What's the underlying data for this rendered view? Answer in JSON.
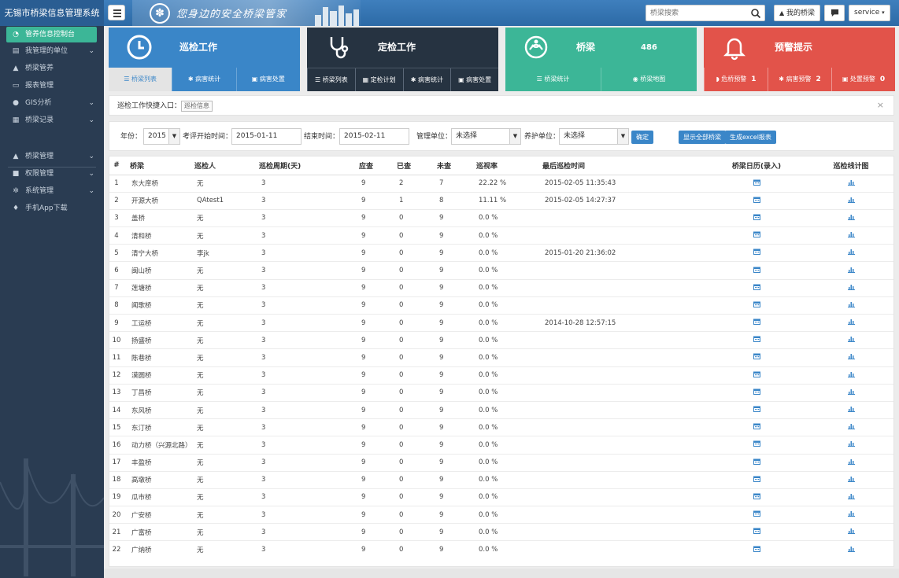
{
  "app": {
    "title": "无锡市桥梁信息管理系统",
    "slogan": "您身边的安全桥梁管家"
  },
  "header": {
    "search_placeholder": "桥梁搜索",
    "my_bridge_label": "我的桥梁",
    "user_label": "service"
  },
  "sidebar": {
    "items": [
      {
        "icon": "dashboard-icon",
        "label": "管养信息控制台",
        "active": true,
        "chevron": false
      },
      {
        "icon": "document-icon",
        "label": "我管理的单位",
        "chevron": true
      },
      {
        "icon": "road-icon",
        "label": "桥梁管养",
        "chevron": false
      },
      {
        "icon": "report-icon",
        "label": "报表管理",
        "chevron": false
      },
      {
        "icon": "map-marker-icon",
        "label": "GIS分析",
        "chevron": true
      },
      {
        "icon": "film-icon",
        "label": "桥梁记录",
        "chevron": true
      },
      {
        "icon": "road-icon",
        "label": "桥梁管理",
        "chevron": true
      },
      {
        "icon": "lock-icon",
        "label": "权限管理",
        "chevron": true
      },
      {
        "icon": "gear-icon",
        "label": "系统管理",
        "chevron": true
      },
      {
        "icon": "android-icon",
        "label": "手机App下载",
        "chevron": false
      }
    ]
  },
  "tiles": [
    {
      "title": "巡检工作",
      "color": "#3a86c8",
      "footer_color": "#e9e9e9",
      "icon": "clock-icon",
      "links": [
        {
          "icon": "list-icon",
          "label": "桥梁列表"
        },
        {
          "icon": "bug-icon",
          "label": "病害统计"
        },
        {
          "icon": "medkit-icon",
          "label": "病害处置"
        }
      ]
    },
    {
      "title": "定检工作",
      "color": "#263341",
      "icon": "stethoscope-icon",
      "links": [
        {
          "icon": "list-icon",
          "label": "桥梁列表"
        },
        {
          "icon": "calendar-icon",
          "label": "定检计划"
        },
        {
          "icon": "bug-icon",
          "label": "病害统计"
        },
        {
          "icon": "medkit-icon",
          "label": "病害处置"
        }
      ]
    },
    {
      "title": "桥梁",
      "count": "486",
      "color": "#3cb697",
      "icon": "bridge-logo-icon",
      "links": [
        {
          "icon": "list-icon",
          "label": "桥梁统计"
        },
        {
          "icon": "globe-icon",
          "label": "桥梁地图"
        }
      ]
    },
    {
      "title": "预警提示",
      "color": "#e2534a",
      "icon": "bell-icon",
      "links": [
        {
          "icon": "shield-icon",
          "label": "危桥预警",
          "count": "1"
        },
        {
          "icon": "bug-icon",
          "label": "病害预警",
          "count": "2"
        },
        {
          "icon": "medkit-icon",
          "label": "处置预警",
          "count": "0"
        }
      ]
    }
  ],
  "quick_entry": {
    "label": "巡检工作快捷入口：",
    "tag": "巡检信息"
  },
  "filter": {
    "year_label": "年份：",
    "year_value": "2015",
    "start_label": "考评开始时间：",
    "start_value": "2015-01-11",
    "end_label": "结束时间：",
    "end_value": "2015-02-11",
    "manage_label": "管理单位：",
    "manage_value": "未选择",
    "maintain_label": "养护单位：",
    "maintain_value": "未选择",
    "confirm_label": "确定",
    "show_all_label": "显示全部桥梁",
    "excel_label": "生成excel报表"
  },
  "table": {
    "columns": [
      "#",
      "桥梁",
      "巡检人",
      "巡检周期(天)",
      "应查",
      "已查",
      "未查",
      "巡视率",
      "最后巡检时间",
      "桥梁日历(录入)",
      "巡检线计图"
    ],
    "rows": [
      [
        "1",
        "东大庠桥",
        "无",
        "3",
        "9",
        "2",
        "7",
        "22.22 %",
        "2015-02-05 11:35:43"
      ],
      [
        "2",
        "开源大桥",
        "QAtest1",
        "3",
        "9",
        "1",
        "8",
        "11.11 %",
        "2015-02-05 14:27:37"
      ],
      [
        "3",
        "盖桥",
        "无",
        "3",
        "9",
        "0",
        "9",
        "0.0 %",
        ""
      ],
      [
        "4",
        "清和桥",
        "无",
        "3",
        "9",
        "0",
        "9",
        "0.0 %",
        ""
      ],
      [
        "5",
        "清宁大桥",
        "李jk",
        "3",
        "9",
        "0",
        "9",
        "0.0 %",
        "2015-01-20 21:36:02"
      ],
      [
        "6",
        "闽山桥",
        "无",
        "3",
        "9",
        "0",
        "9",
        "0.0 %",
        ""
      ],
      [
        "7",
        "莲塘桥",
        "无",
        "3",
        "9",
        "0",
        "9",
        "0.0 %",
        ""
      ],
      [
        "8",
        "闻歌桥",
        "无",
        "3",
        "9",
        "0",
        "9",
        "0.0 %",
        ""
      ],
      [
        "9",
        "工运桥",
        "无",
        "3",
        "9",
        "0",
        "9",
        "0.0 %",
        "2014-10-28 12:57:15"
      ],
      [
        "10",
        "扬盛桥",
        "无",
        "3",
        "9",
        "0",
        "9",
        "0.0 %",
        ""
      ],
      [
        "11",
        "陈巷桥",
        "无",
        "3",
        "9",
        "0",
        "9",
        "0.0 %",
        ""
      ],
      [
        "12",
        "漠圆桥",
        "无",
        "3",
        "9",
        "0",
        "9",
        "0.0 %",
        ""
      ],
      [
        "13",
        "丁昌桥",
        "无",
        "3",
        "9",
        "0",
        "9",
        "0.0 %",
        ""
      ],
      [
        "14",
        "东风桥",
        "无",
        "3",
        "9",
        "0",
        "9",
        "0.0 %",
        ""
      ],
      [
        "15",
        "东汀桥",
        "无",
        "3",
        "9",
        "0",
        "9",
        "0.0 %",
        ""
      ],
      [
        "16",
        "动力桥（兴源北路）",
        "无",
        "3",
        "9",
        "0",
        "9",
        "0.0 %",
        ""
      ],
      [
        "17",
        "丰盈桥",
        "无",
        "3",
        "9",
        "0",
        "9",
        "0.0 %",
        ""
      ],
      [
        "18",
        "高墩桥",
        "无",
        "3",
        "9",
        "0",
        "9",
        "0.0 %",
        ""
      ],
      [
        "19",
        "瓜市桥",
        "无",
        "3",
        "9",
        "0",
        "9",
        "0.0 %",
        ""
      ],
      [
        "20",
        "广安桥",
        "无",
        "3",
        "9",
        "0",
        "9",
        "0.0 %",
        ""
      ],
      [
        "21",
        "广富桥",
        "无",
        "3",
        "9",
        "0",
        "9",
        "0.0 %",
        ""
      ],
      [
        "22",
        "广纳桥",
        "无",
        "3",
        "9",
        "0",
        "9",
        "0.0 %",
        ""
      ]
    ]
  }
}
